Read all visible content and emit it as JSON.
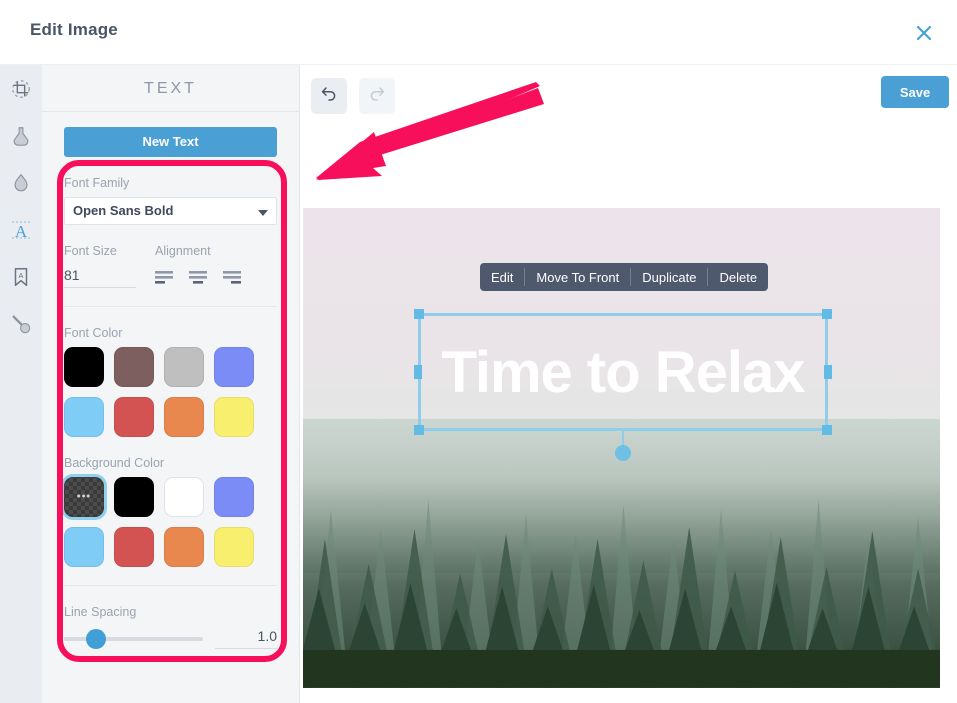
{
  "window": {
    "title": "Edit Image",
    "close_icon": "close-icon"
  },
  "rail": {
    "items": [
      {
        "name": "crop-icon",
        "label": "Crop",
        "active": false
      },
      {
        "name": "flask-icon",
        "label": "Filters",
        "active": false
      },
      {
        "name": "droplet-icon",
        "label": "Adjust",
        "active": false
      },
      {
        "name": "text-icon",
        "label": "Text",
        "active": true
      },
      {
        "name": "sticker-icon",
        "label": "Stickers",
        "active": false
      },
      {
        "name": "brush-icon",
        "label": "Draw",
        "active": false
      }
    ]
  },
  "panel": {
    "title": "TEXT",
    "new_text_label": "New Text",
    "font_family": {
      "label": "Font Family",
      "value": "Open Sans Bold"
    },
    "font_size": {
      "label": "Font Size",
      "value": "81",
      "placeholder": "Size"
    },
    "alignment": {
      "label": "Alignment",
      "options": [
        "align-left",
        "align-center",
        "align-right"
      ],
      "selected": "align-left"
    },
    "font_color": {
      "label": "Font Color",
      "swatches": [
        "#000000",
        "#7d5f5f",
        "#bfbfbf",
        "#7b8cf7",
        "#7fcdf7",
        "#d35353",
        "#e8884f",
        "#f9ef6e"
      ],
      "selected_index": -1
    },
    "background_color": {
      "label": "Background Color",
      "swatches": [
        "transparent",
        "#000000",
        "#ffffff",
        "#7b8cf7",
        "#7fcdf7",
        "#d35353",
        "#e8884f",
        "#f9ef6e"
      ],
      "selected_index": 0
    },
    "line_spacing": {
      "label": "Line Spacing",
      "value": "1.0"
    }
  },
  "toolbar": {
    "undo_label": "Undo",
    "redo_label": "Redo",
    "save_label": "Save"
  },
  "context_menu": {
    "items": [
      "Edit",
      "Move To Front",
      "Duplicate",
      "Delete"
    ]
  },
  "canvas": {
    "text_object": {
      "value": "Time to Relax",
      "color": "#ffffff"
    }
  },
  "annotation": {
    "arrow_color": "#f70f5c",
    "highlight_color": "#f70f5c"
  }
}
